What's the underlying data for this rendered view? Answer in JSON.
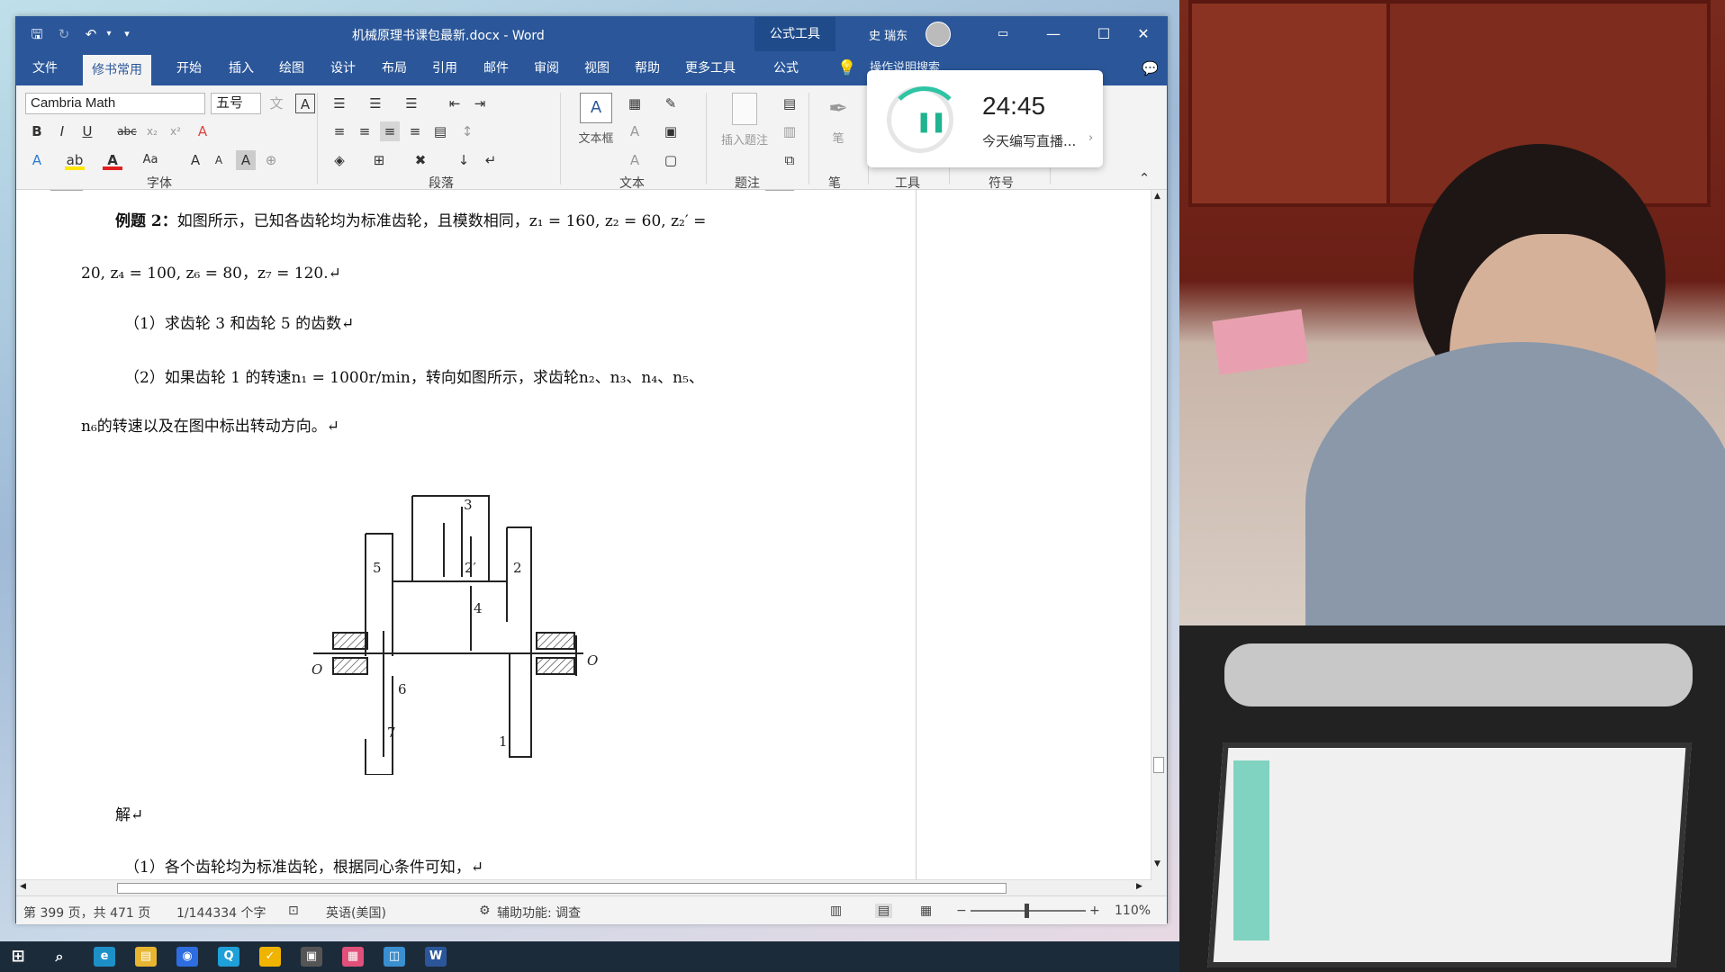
{
  "window": {
    "title": "机械原理书课包最新.docx - Word",
    "context_tab": "公式工具",
    "user": "史 瑞东"
  },
  "tabs": [
    "文件",
    "修书常用",
    "开始",
    "插入",
    "绘图",
    "设计",
    "布局",
    "引用",
    "邮件",
    "审阅",
    "视图",
    "帮助",
    "更多工具",
    "公式"
  ],
  "search_hint": "操作说明搜索",
  "ribbon": {
    "font_name": "Cambria Math",
    "font_size": "五号",
    "groups": {
      "font": "字体",
      "paragraph": "段落",
      "text": "文本",
      "caption": "题注",
      "pen": "笔",
      "tools": "工具",
      "symbols": "符号"
    },
    "textbox_label": "文本框",
    "insert_caption_label": "插入题注",
    "pen_label": "笔"
  },
  "timer": {
    "time": "24:45",
    "label": "今天编写直播..."
  },
  "document": {
    "line1_bold": "例题 2：",
    "line1": "如图所示，已知各齿轮均为标准齿轮，且模数相同，z₁ = 160, z₂ = 60, z₂′ =",
    "line2": "20, z₄ = 100, z₆ = 80，z₇ = 120.↵",
    "line3": "（1）求齿轮 3 和齿轮 5 的齿数↵",
    "line4": "（2）如果齿轮 1 的转速n₁ = 1000r/min，转向如图所示，求齿轮n₂、n₃、n₄、n₅、",
    "line5": "n₆的转速以及在图中标出转动方向。↵",
    "figure_labels": {
      "l3": "3",
      "l5": "5",
      "l2p": "2′",
      "l2": "2",
      "l4": "4",
      "l6": "6",
      "l7": "7",
      "l1": "1",
      "o1": "O",
      "o2": "O"
    },
    "line6": "解↵",
    "line7": "（1）各个齿轮均为标准齿轮，根据同心条件可知，↵"
  },
  "status": {
    "page": "第 399 页，共 471 页",
    "words": "1/144334 个字",
    "language": "英语(美国)",
    "accessibility": "辅助功能: 调查",
    "zoom": "110%"
  }
}
